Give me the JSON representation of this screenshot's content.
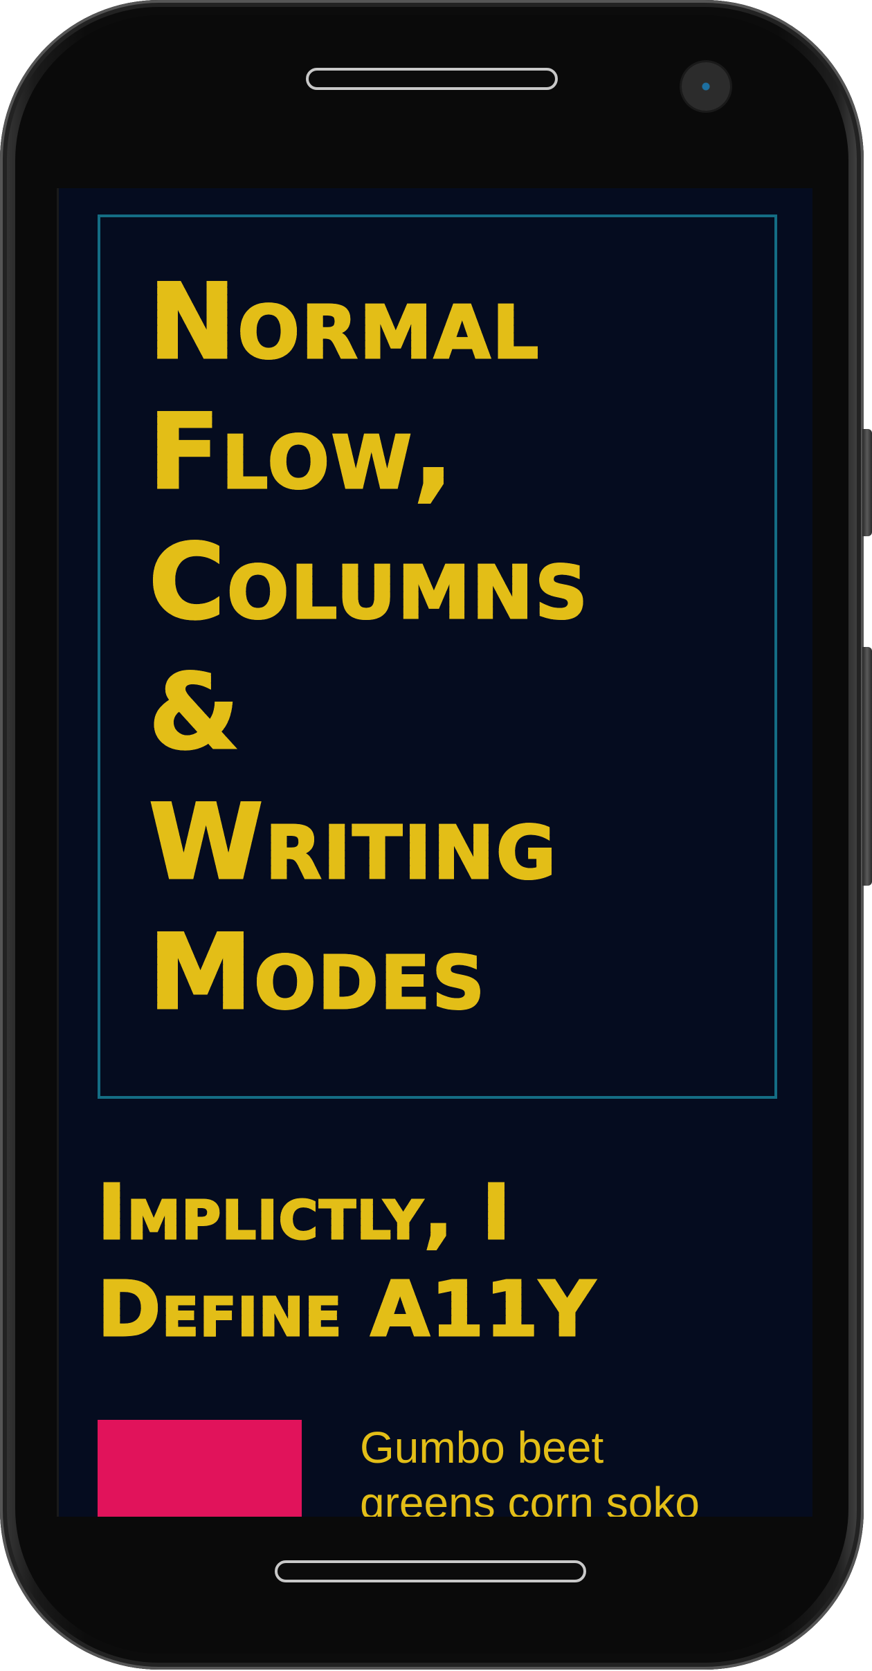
{
  "theme": {
    "screen_bg": "#050c1f",
    "accent_yellow": "#e3be17",
    "frame_teal": "#146d84",
    "box_pink": "#e1135b"
  },
  "device": {
    "speaker_icon": "speaker-grille",
    "camera_icon": "front-camera",
    "home_icon": "home-bar"
  },
  "hero": {
    "title_lines": [
      "Normal",
      "Flow,",
      "Columns",
      "&",
      "Writing",
      "Modes"
    ]
  },
  "section": {
    "title_lines": [
      "Implictly, I",
      "Define A11Y"
    ],
    "body_lines": [
      "Gumbo beet",
      "greens corn soko"
    ]
  }
}
